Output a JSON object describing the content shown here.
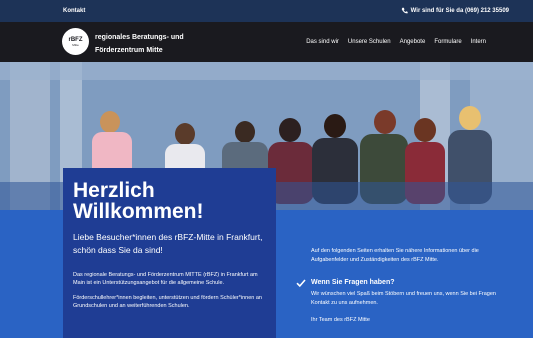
{
  "topbar": {
    "contact": "Kontakt",
    "phone": "Wir sind für Sie da (069) 212 35509"
  },
  "header": {
    "logo_text": "rBFZ",
    "logo_subtext": "Mitte",
    "org_line1": "regionales Beratungs- und",
    "org_line2": "Förderzentrum Mitte",
    "nav": [
      "Das sind wir",
      "Unsere Schulen",
      "Angebote",
      "Formulare",
      "Intern"
    ]
  },
  "welcome": {
    "title": "Herzlich Willkommen!",
    "lead": "Liebe Besucher*innen des rBFZ-Mitte in Frankfurt, schön dass Sie da sind!",
    "para1": "Das regionale Beratungs- und Förderzentrum MITTE (rBFZ) in Frankfurt am Main ist ein Unterstützungsangebot für die allgemeine Schule.",
    "para2": "Förderschullehrer*innen begleiten, unterstützen und fördern Schüler*innen an Grundschulen und an weiterführenden Schulen."
  },
  "info": {
    "intro": "Auf den folgenden Seiten erhalten Sie nähere Informationen über die Aufgabenfelder und Zuständigkeiten des rBFZ Mitte.",
    "faq_heading": "Wenn Sie Fragen haben?",
    "faq_text": "Wir wünschen viel Spaß beim Stöbern und freuen uns, wenn Sie bei Fragen Kontakt zu uns aufnehmen.",
    "signoff": "Ihr Team des rBFZ Mitte"
  },
  "icons": {
    "phone": "phone-icon",
    "check": "check-icon"
  },
  "colors": {
    "topbar": "#1d3357",
    "navbar": "#1a1a1f",
    "card": "#1f3d94",
    "band": "#2a63c4"
  }
}
